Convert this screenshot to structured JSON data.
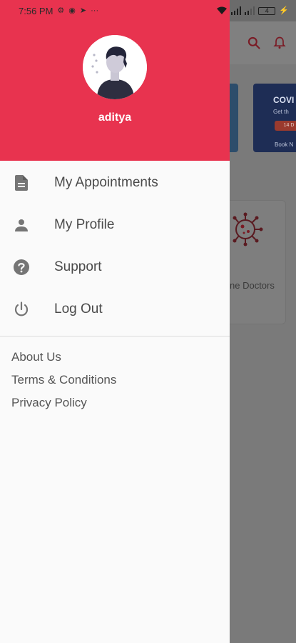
{
  "status_bar": {
    "time": "7:56 PM",
    "icons_left": [
      "settings-icon",
      "record-icon",
      "telegram-icon",
      "more-icon"
    ],
    "battery_level": "4"
  },
  "drawer": {
    "user": {
      "name": "aditya"
    },
    "menu_items": [
      {
        "label": "My Appointments",
        "icon": "document-icon"
      },
      {
        "label": "My Profile",
        "icon": "person-icon"
      },
      {
        "label": "Support",
        "icon": "help-icon"
      },
      {
        "label": "Log Out",
        "icon": "power-icon"
      }
    ],
    "footer_links": [
      {
        "label": "About Us"
      },
      {
        "label": "Terms & Conditions"
      },
      {
        "label": "Privacy Policy"
      }
    ]
  },
  "background_app": {
    "banner_title": "COVI",
    "banner_subtitle": "Get th",
    "banner_pill": "14 D",
    "banner_cta": "Book N",
    "doctors_label": "ne Doctors"
  },
  "colors": {
    "brand_red": "#e8334f",
    "drawer_bg": "#fafafa",
    "icon_gray": "#757575"
  }
}
